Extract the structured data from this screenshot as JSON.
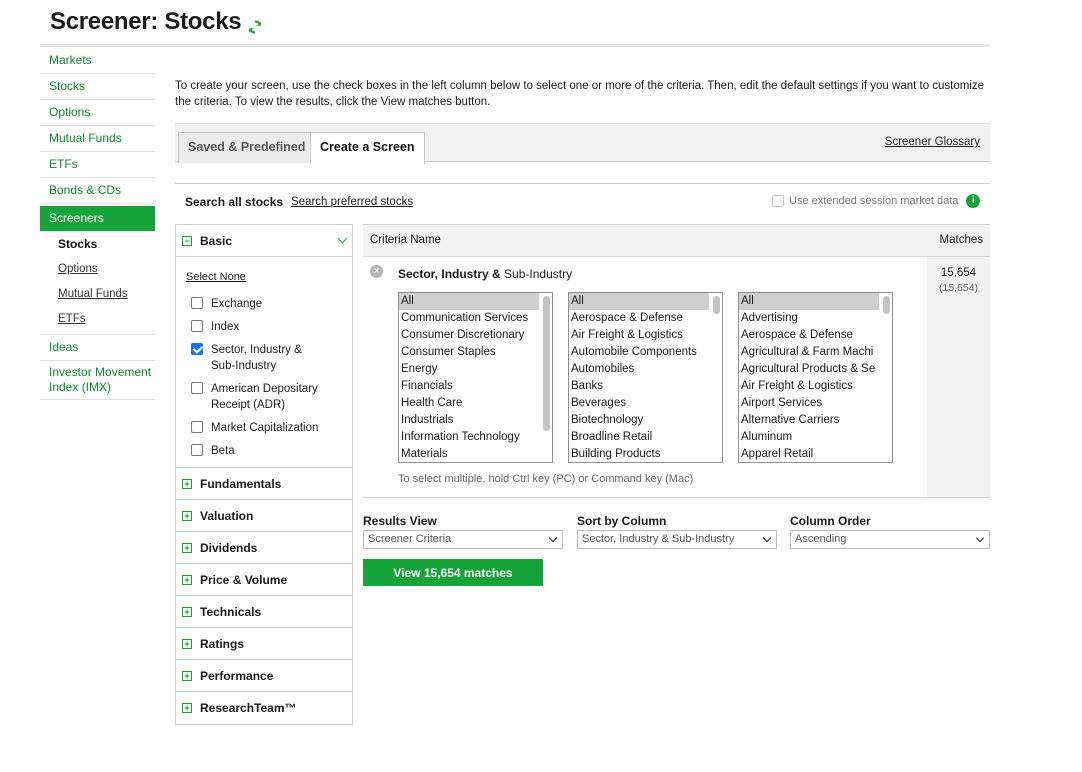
{
  "title": "Screener: Stocks",
  "nav": {
    "items": [
      {
        "label": "Markets"
      },
      {
        "label": "Stocks"
      },
      {
        "label": "Options"
      },
      {
        "label": "Mutual Funds"
      },
      {
        "label": "ETFs"
      },
      {
        "label": "Bonds & CDs"
      }
    ],
    "screeners_label": "Screeners",
    "screeners_sub": [
      {
        "label": "Stocks"
      },
      {
        "label": "Options"
      },
      {
        "label": "Mutual Funds"
      },
      {
        "label": "ETFs"
      }
    ],
    "ideas_label": "Ideas",
    "imx_label": "Investor Movement Index (IMX)"
  },
  "intro": "To create your screen, use the check boxes in the left column below to select one or more of the criteria. Then, edit the default settings if you want to customize the criteria. To view the results, click the View matches button.",
  "tabs": {
    "saved": "Saved & Predefined",
    "create": "Create a Screen",
    "glossary": "Screener Glossary"
  },
  "search": {
    "all": "Search all stocks",
    "preferred": "Search preferred stocks",
    "extended": "Use extended session market data"
  },
  "criteria_panel": {
    "basic": "Basic",
    "select_none": "Select None",
    "options": [
      {
        "label": "Exchange",
        "checked": false
      },
      {
        "label": "Index",
        "checked": false
      },
      {
        "label": "Sector, Industry & Sub-Industry",
        "checked": true
      },
      {
        "label": "American Depositary Receipt (ADR)",
        "checked": false
      },
      {
        "label": "Market Capitalization",
        "checked": false
      },
      {
        "label": "Beta",
        "checked": false
      }
    ],
    "categories": [
      "Fundamentals",
      "Valuation",
      "Dividends",
      "Price & Volume",
      "Technicals",
      "Ratings",
      "Performance",
      "ResearchTeam™"
    ]
  },
  "criteria_table": {
    "col_name": "Criteria Name",
    "col_matches": "Matches",
    "row_title_bold": "Sector, Industry &",
    "row_title_rest": " Sub-Industry",
    "matches": "15,654",
    "matches_total": "(15,654)",
    "hint": "To select multiple, hold Ctrl key (PC) or Command key (Mac)",
    "sectors": [
      "All",
      "Communication Services",
      "Consumer Discretionary",
      "Consumer Staples",
      "Energy",
      "Financials",
      "Health Care",
      "Industrials",
      "Information Technology",
      "Materials"
    ],
    "industries": [
      "All",
      "Aerospace & Defense",
      "Air Freight & Logistics",
      "Automobile Components",
      "Automobiles",
      "Banks",
      "Beverages",
      "Biotechnology",
      "Broadline Retail",
      "Building Products"
    ],
    "sub_industries": [
      "All",
      "Advertising",
      "Aerospace & Defense",
      "Agricultural & Farm Machi",
      "Agricultural Products & Se",
      "Air Freight & Logistics",
      "Airport Services",
      "Alternative Carriers",
      "Aluminum",
      "Apparel Retail"
    ]
  },
  "results": {
    "view_label": "Results View",
    "view_value": "Screener Criteria",
    "sort_label": "Sort by Column",
    "sort_value": "Sector, Industry & Sub-Industry",
    "order_label": "Column Order",
    "order_value": "Ascending",
    "button": "View 15,654 matches"
  },
  "colors": {
    "brand_green": "#16a43a",
    "link_green": "#12852f"
  }
}
